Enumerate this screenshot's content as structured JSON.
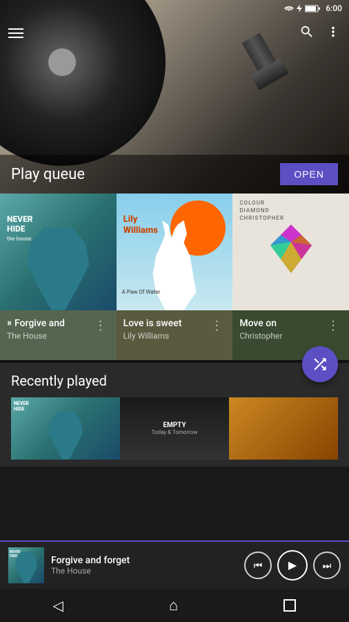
{
  "statusBar": {
    "time": "6:00",
    "icons": [
      "wifi",
      "bolt",
      "battery"
    ]
  },
  "topBar": {
    "menuLabel": "Menu",
    "searchLabel": "Search",
    "moreLabel": "More options"
  },
  "hero": {
    "title": "Play queue",
    "openButton": "OPEN"
  },
  "albums": [
    {
      "id": "album-1",
      "artLabel": "NEVER HIDE",
      "subLabel": "the house",
      "trackName": "Forgive and",
      "trackArtist": "The House",
      "playing": true,
      "barColor": "#556650"
    },
    {
      "id": "album-2",
      "artLabel": "Lily Williams",
      "subLabel": "A Paw Of Water",
      "trackName": "Love is sweet",
      "trackArtist": "Lily Williams",
      "playing": false,
      "barColor": "#5a5a40"
    },
    {
      "id": "album-3",
      "artLabel": "COLOUR DIAMOND CHRISTOPHER",
      "subLabel": "",
      "trackName": "Move on",
      "trackArtist": "Christopher",
      "playing": false,
      "barColor": "#3a4a30"
    }
  ],
  "recentlyPlayed": {
    "title": "Recently played",
    "shuffleLabel": "Shuffle",
    "thumbs": [
      {
        "label": "",
        "type": "neverhide"
      },
      {
        "label": "EMPTY\nToday & Tomorrow",
        "type": "empty"
      },
      {
        "label": "",
        "type": "fire"
      }
    ]
  },
  "nowPlaying": {
    "title": "Forgive and forget",
    "artist": "The House",
    "prevLabel": "Previous",
    "playLabel": "Play",
    "nextLabel": "Next"
  },
  "navBar": {
    "back": "◁",
    "home": "⌂",
    "recent": "☐"
  }
}
